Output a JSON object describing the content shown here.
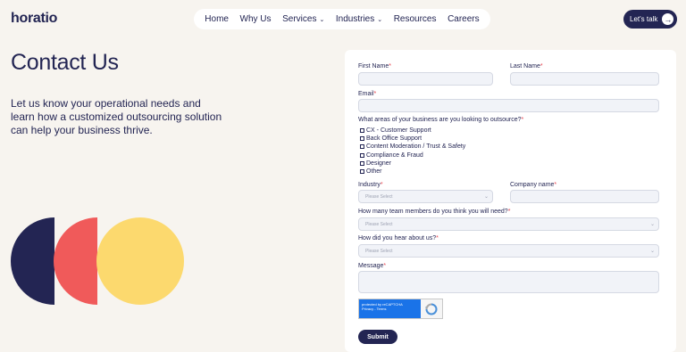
{
  "brand": {
    "logo_text": "horatio"
  },
  "nav": {
    "items": [
      {
        "label": "Home",
        "has_dropdown": false
      },
      {
        "label": "Why Us",
        "has_dropdown": false
      },
      {
        "label": "Services",
        "has_dropdown": true
      },
      {
        "label": "Industries",
        "has_dropdown": true
      },
      {
        "label": "Resources",
        "has_dropdown": false
      },
      {
        "label": "Careers",
        "has_dropdown": false
      }
    ],
    "cta_label": "Let's talk",
    "cta_icon": "arrow-right-icon"
  },
  "hero": {
    "title": "Contact Us",
    "subtitle": "Let us know your operational needs and learn how a customized outsourcing solution can help your business thrive."
  },
  "colors": {
    "navy": "#232553",
    "coral": "#f05a5a",
    "yellow": "#fcd96e",
    "background": "#f7f4ef",
    "required": "#e8444f"
  },
  "form": {
    "first_name_label": "First Name",
    "last_name_label": "Last Name",
    "email_label": "Email",
    "outsource_question": "What areas of your business are you looking to outsource?",
    "outsource_options": [
      "CX - Customer Support",
      "Back Office Support",
      "Content Moderation / Trust & Safety",
      "Compliance & Fraud",
      "Designer",
      "Other"
    ],
    "industry_label": "Industry",
    "industry_placeholder": "Please Select",
    "company_label": "Company name",
    "team_size_label": "How many team members do you think you will need?",
    "team_size_placeholder": "Please Select",
    "hear_label": "How did you hear about us?",
    "hear_placeholder": "Please Select",
    "message_label": "Message",
    "required_mark": "*",
    "captcha_text": "protected by reCAPTCHA",
    "captcha_links": "Privacy - Terms",
    "submit_label": "Submit"
  }
}
